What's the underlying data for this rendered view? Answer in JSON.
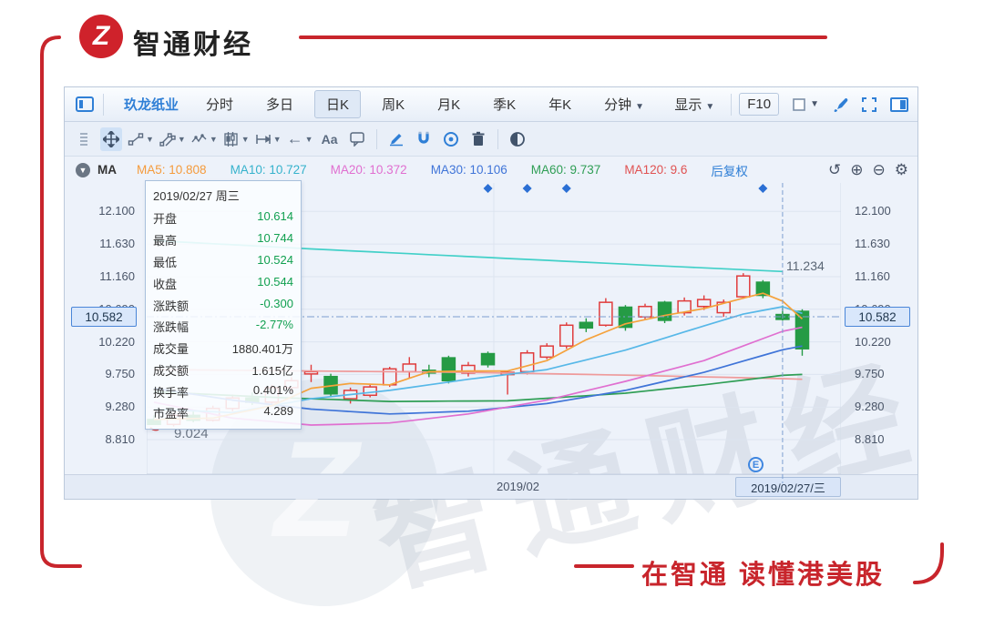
{
  "brand": {
    "logo_letter": "Z",
    "logo_text": "智通财经",
    "slogan": "在智通  读懂港美股",
    "brand_red": "#c8252c"
  },
  "tabbar": {
    "stock_name": "玖龙纸业",
    "tabs": [
      "分时",
      "多日",
      "日K",
      "周K",
      "月K",
      "季K",
      "年K"
    ],
    "active_tab": "日K",
    "minute_dropdown": "分钟",
    "display_dropdown": "显示",
    "f10_label": "F10",
    "icons": [
      "panel-toggle-icon",
      "square-select-icon",
      "brush-icon",
      "expand-icon",
      "split-panel-icon"
    ]
  },
  "toolbar": {
    "text_tool_label": "Aa",
    "icons": [
      "drag-grip",
      "move-tool",
      "trendline-tool",
      "channel-tool",
      "wave-tool",
      "pattern-tool",
      "measure-tool",
      "arrow-tool",
      "text-tool",
      "comment-tool",
      "draw-tool",
      "magnet-tool",
      "target-tool",
      "delete-tool",
      "contrast-toggle"
    ]
  },
  "ma_bar": {
    "title": "MA",
    "items": [
      {
        "name": "MA5",
        "value": "10.808",
        "color": "#f59b3c"
      },
      {
        "name": "MA10",
        "value": "10.727",
        "color": "#35b2cc"
      },
      {
        "name": "MA20",
        "value": "10.372",
        "color": "#e06fd0"
      },
      {
        "name": "MA30",
        "value": "10.106",
        "color": "#3f74d8"
      },
      {
        "name": "MA60",
        "value": "9.737",
        "color": "#2f9e55"
      },
      {
        "name": "MA120",
        "value": "9.6",
        "color": "#e05252"
      }
    ],
    "adjust_mode": "后复权",
    "icons": [
      "undo-icon",
      "zoom-in-icon",
      "zoom-out-icon",
      "gear-icon"
    ]
  },
  "tooltip": {
    "date": "2019/02/27",
    "weekday": "周三",
    "rows": [
      {
        "label": "开盘",
        "value": "10.614",
        "tone": "down"
      },
      {
        "label": "最高",
        "value": "10.744",
        "tone": "down"
      },
      {
        "label": "最低",
        "value": "10.524",
        "tone": "down"
      },
      {
        "label": "收盘",
        "value": "10.544",
        "tone": "down"
      },
      {
        "label": "涨跌额",
        "value": "-0.300",
        "tone": "down"
      },
      {
        "label": "涨跌幅",
        "value": "-2.77%",
        "tone": "down"
      },
      {
        "label": "成交量",
        "value": "1880.401万",
        "tone": "plain"
      },
      {
        "label": "成交额",
        "value": "1.615亿",
        "tone": "plain"
      },
      {
        "label": "换手率",
        "value": "0.401%",
        "tone": "plain"
      },
      {
        "label": "市盈率",
        "value": "4.289",
        "tone": "plain"
      }
    ]
  },
  "axis": {
    "crosshair_price": "10.582",
    "month_label": "2019/02",
    "cursor_date_label": "2019/02/27/三",
    "ma250_end_label": "11.234",
    "low_annotation": "9.024",
    "event_badge": "E"
  },
  "chart_data": {
    "type": "candlestick",
    "period": "daily",
    "y_axis": {
      "labels": [
        "12.100",
        "11.630",
        "11.160",
        "10.690",
        "10.220",
        "9.750",
        "9.280",
        "8.810"
      ],
      "values": [
        12.1,
        11.63,
        11.16,
        10.69,
        10.22,
        9.75,
        9.28,
        8.81
      ],
      "crosshair_value": 10.582
    },
    "x_axis": {
      "month_label": "2019/02",
      "month_tick_index": 17.3,
      "cursor_label": "2019/02/27/三"
    },
    "cursor_index": 32,
    "colors": {
      "up": "#e03c3c",
      "down": "#259b45",
      "crosshair": "#7d9fd0",
      "grid": "#dde4f0"
    },
    "ohlc": [
      [
        9.1,
        9.16,
        9.024,
        9.03
      ],
      [
        9.03,
        9.2,
        9.0,
        9.16
      ],
      [
        9.16,
        9.24,
        9.06,
        9.09
      ],
      [
        9.09,
        9.3,
        9.07,
        9.26
      ],
      [
        9.26,
        9.46,
        9.22,
        9.41
      ],
      [
        9.41,
        9.49,
        9.31,
        9.35
      ],
      [
        9.35,
        9.6,
        9.33,
        9.56
      ],
      [
        9.56,
        9.71,
        9.5,
        9.66
      ],
      [
        9.76,
        9.89,
        9.64,
        9.79
      ],
      [
        9.72,
        9.76,
        9.42,
        9.47
      ],
      [
        9.4,
        9.56,
        9.33,
        9.52
      ],
      [
        9.45,
        9.6,
        9.42,
        9.57
      ],
      [
        9.6,
        9.86,
        9.57,
        9.83
      ],
      [
        9.79,
        10.0,
        9.7,
        9.9
      ],
      [
        9.81,
        9.89,
        9.71,
        9.77
      ],
      [
        9.99,
        10.02,
        9.62,
        9.66
      ],
      [
        9.77,
        9.93,
        9.72,
        9.88
      ],
      [
        10.05,
        10.08,
        9.85,
        9.89
      ],
      [
        9.76,
        9.8,
        9.46,
        9.78
      ],
      [
        9.79,
        10.1,
        9.75,
        10.06
      ],
      [
        10.0,
        10.2,
        9.97,
        10.16
      ],
      [
        10.16,
        10.5,
        10.12,
        10.46
      ],
      [
        10.5,
        10.56,
        10.36,
        10.42
      ],
      [
        10.46,
        10.85,
        10.44,
        10.79
      ],
      [
        10.72,
        10.75,
        10.38,
        10.43
      ],
      [
        10.58,
        10.77,
        10.55,
        10.73
      ],
      [
        10.79,
        10.81,
        10.49,
        10.53
      ],
      [
        10.64,
        10.86,
        10.6,
        10.81
      ],
      [
        10.73,
        10.89,
        10.68,
        10.83
      ],
      [
        10.64,
        10.83,
        10.58,
        10.79
      ],
      [
        10.87,
        11.21,
        10.84,
        11.17
      ],
      [
        11.08,
        11.11,
        10.85,
        10.89
      ],
      [
        10.614,
        10.744,
        10.524,
        10.544
      ],
      [
        10.66,
        10.69,
        10.02,
        10.12
      ]
    ],
    "ma_series": [
      {
        "name": "MA250",
        "color": "#41d0c8",
        "points": [
          [
            0,
            11.68
          ],
          [
            8,
            11.56
          ],
          [
            16,
            11.45
          ],
          [
            24,
            11.34
          ],
          [
            32,
            11.234
          ]
        ]
      },
      {
        "name": "MA120",
        "color": "#ef9a9a",
        "points": [
          [
            0,
            9.82
          ],
          [
            8,
            9.8
          ],
          [
            16,
            9.78
          ],
          [
            24,
            9.74
          ],
          [
            32,
            9.69
          ],
          [
            33,
            9.68
          ]
        ]
      },
      {
        "name": "MA60",
        "color": "#2f9e55",
        "points": [
          [
            0,
            9.5
          ],
          [
            6,
            9.42
          ],
          [
            12,
            9.36
          ],
          [
            18,
            9.37
          ],
          [
            24,
            9.48
          ],
          [
            28,
            9.6
          ],
          [
            32,
            9.737
          ],
          [
            33,
            9.75
          ]
        ]
      },
      {
        "name": "MA30",
        "color": "#3f74d8",
        "points": [
          [
            0,
            9.55
          ],
          [
            4,
            9.38
          ],
          [
            8,
            9.25
          ],
          [
            12,
            9.18
          ],
          [
            16,
            9.22
          ],
          [
            20,
            9.33
          ],
          [
            24,
            9.52
          ],
          [
            28,
            9.78
          ],
          [
            32,
            10.106
          ],
          [
            33,
            10.16
          ]
        ]
      },
      {
        "name": "MA20",
        "color": "#e06fd0",
        "points": [
          [
            0,
            9.35
          ],
          [
            4,
            9.12
          ],
          [
            8,
            9.02
          ],
          [
            12,
            9.05
          ],
          [
            16,
            9.18
          ],
          [
            20,
            9.38
          ],
          [
            24,
            9.65
          ],
          [
            28,
            9.95
          ],
          [
            32,
            10.372
          ],
          [
            33,
            10.43
          ]
        ]
      },
      {
        "name": "MA10",
        "color": "#57b8e8",
        "points": [
          [
            0,
            9.25
          ],
          [
            4,
            9.2
          ],
          [
            8,
            9.4
          ],
          [
            12,
            9.52
          ],
          [
            16,
            9.68
          ],
          [
            20,
            9.82
          ],
          [
            24,
            10.1
          ],
          [
            28,
            10.45
          ],
          [
            30,
            10.62
          ],
          [
            32,
            10.727
          ],
          [
            33,
            10.63
          ]
        ]
      },
      {
        "name": "MA5",
        "color": "#f5a23c",
        "points": [
          [
            0,
            9.1
          ],
          [
            3,
            9.12
          ],
          [
            6,
            9.3
          ],
          [
            8,
            9.55
          ],
          [
            10,
            9.62
          ],
          [
            12,
            9.6
          ],
          [
            14,
            9.79
          ],
          [
            16,
            9.8
          ],
          [
            18,
            9.8
          ],
          [
            20,
            9.95
          ],
          [
            22,
            10.25
          ],
          [
            24,
            10.48
          ],
          [
            26,
            10.6
          ],
          [
            28,
            10.7
          ],
          [
            30,
            10.85
          ],
          [
            31,
            10.92
          ],
          [
            32,
            10.808
          ],
          [
            33,
            10.55
          ]
        ]
      }
    ],
    "event_indices": [
      17,
      19,
      21,
      31
    ],
    "low_annotation": {
      "index": 0,
      "value": 9.024
    }
  }
}
